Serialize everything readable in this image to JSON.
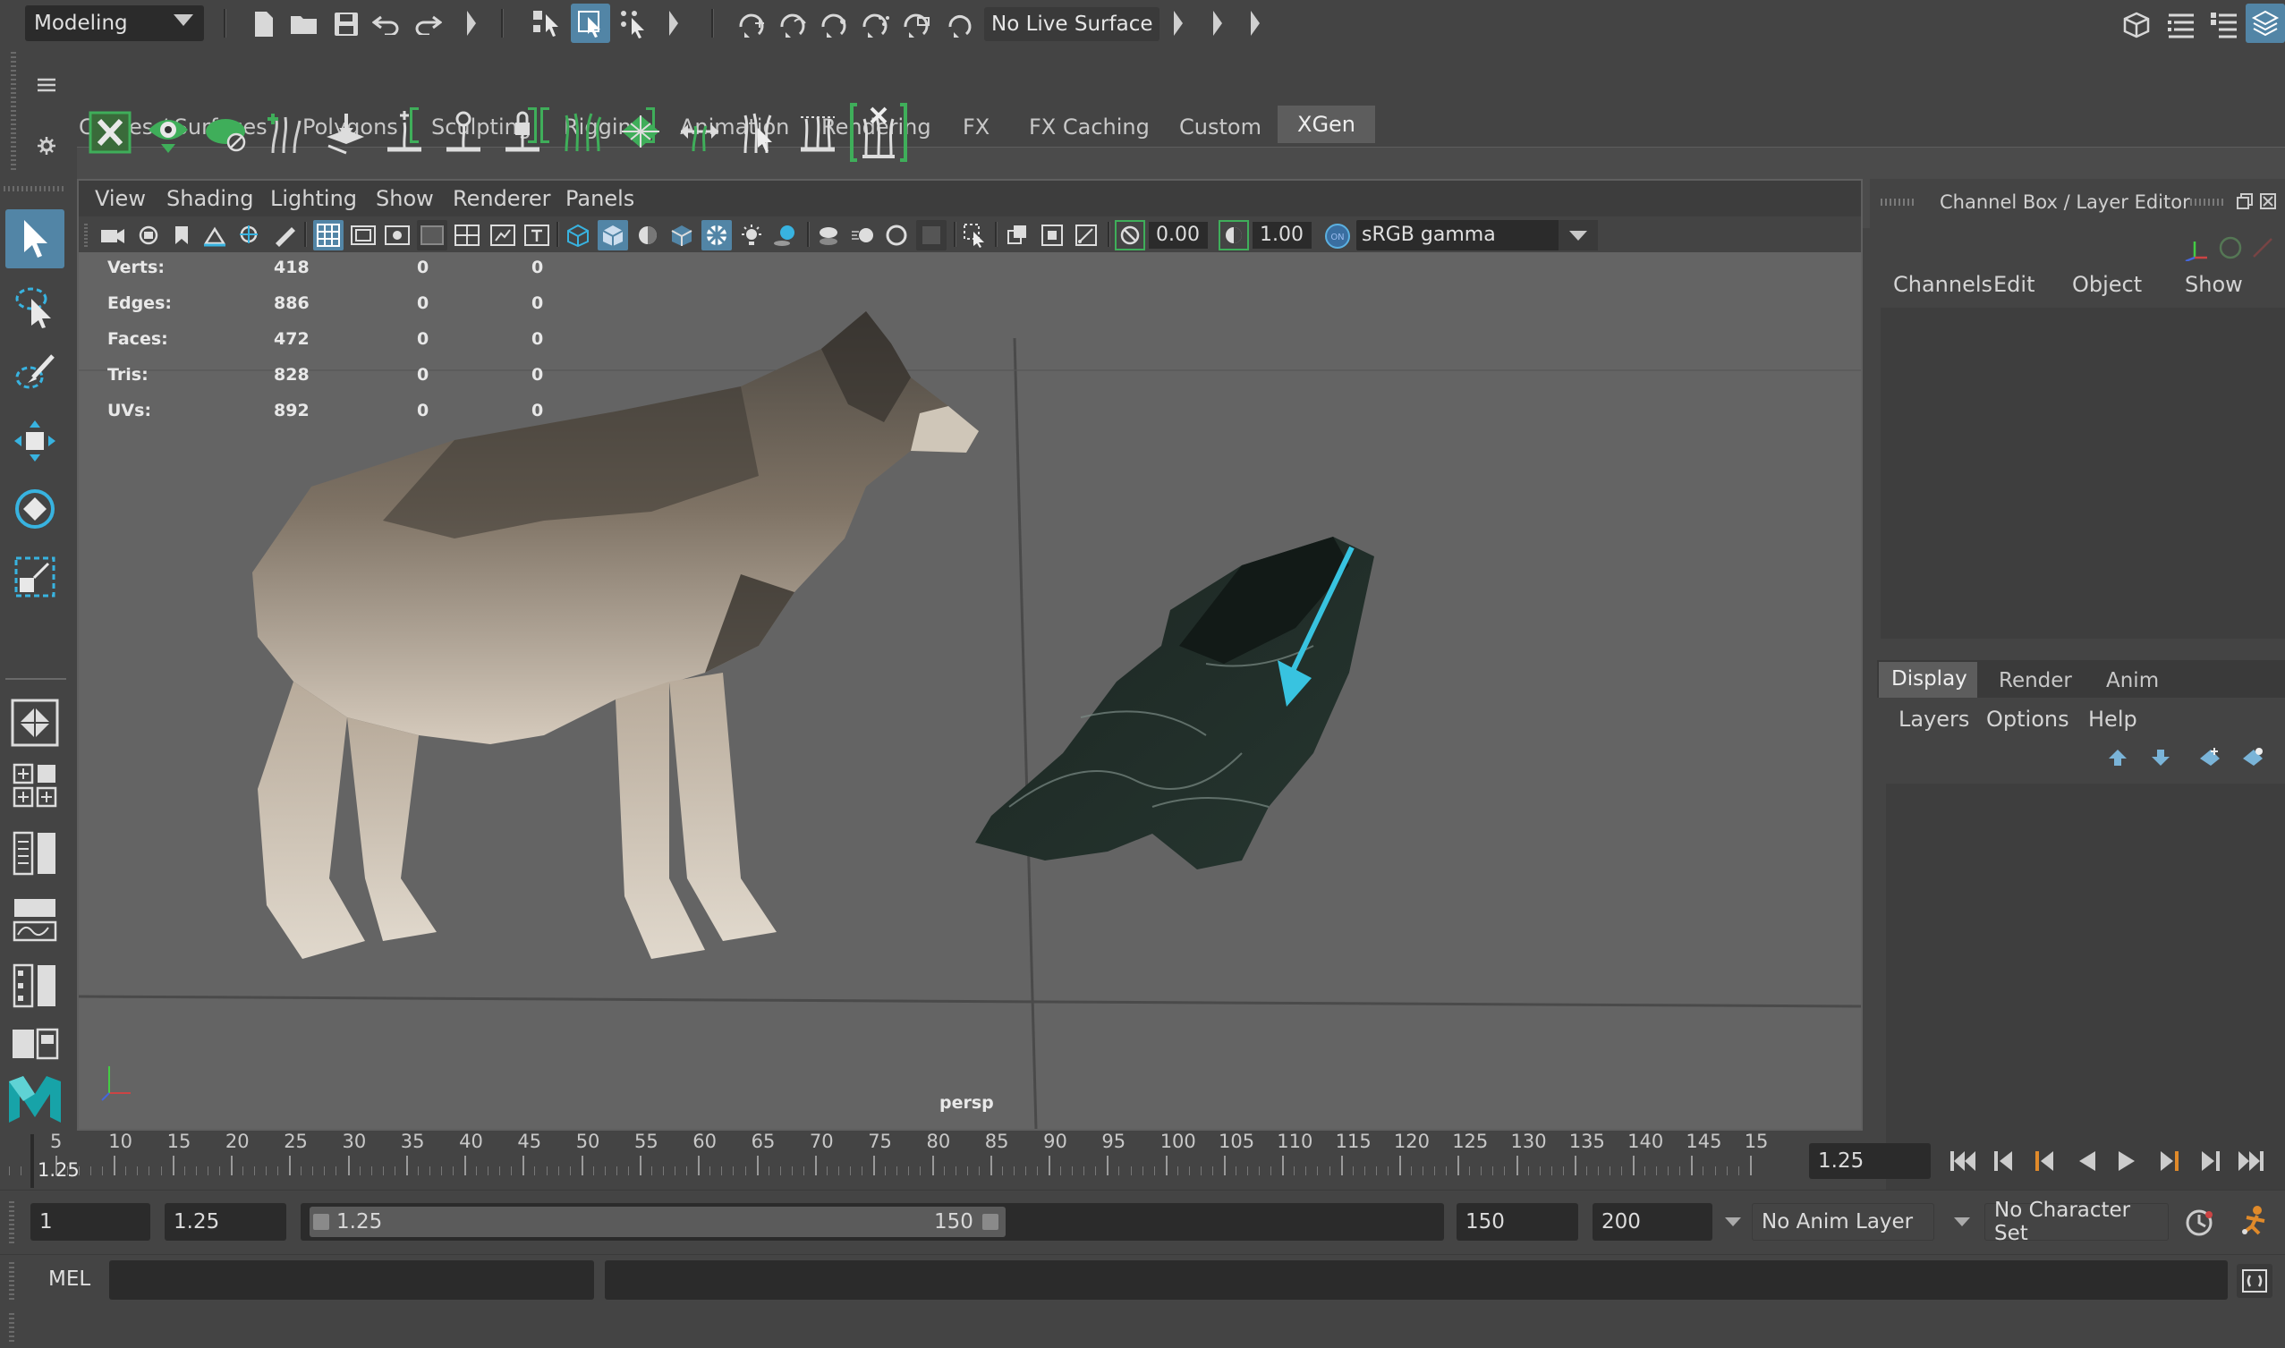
{
  "status_line": {
    "menu_set": "Modeling",
    "live_surface": "No Live Surface"
  },
  "shelf": {
    "tabs": [
      "Curves / Surfaces",
      "Polygons",
      "Sculpting",
      "Rigging",
      "Animation",
      "Rendering",
      "FX",
      "FX Caching",
      "Custom",
      "XGen"
    ],
    "active_tab": "XGen"
  },
  "panel_menu": [
    "View",
    "Shading",
    "Lighting",
    "Show",
    "Renderer",
    "Panels"
  ],
  "panel_toolbar": {
    "exposure": "0.00",
    "gamma": "1.00",
    "color_space": "sRGB gamma"
  },
  "hud": {
    "rows": [
      {
        "label": "Verts:",
        "a": "418",
        "b": "0",
        "c": "0"
      },
      {
        "label": "Edges:",
        "a": "886",
        "b": "0",
        "c": "0"
      },
      {
        "label": "Faces:",
        "a": "472",
        "b": "0",
        "c": "0"
      },
      {
        "label": "Tris:",
        "a": "828",
        "b": "0",
        "c": "0"
      },
      {
        "label": "UVs:",
        "a": "892",
        "b": "0",
        "c": "0"
      }
    ],
    "camera": "persp"
  },
  "channel_box": {
    "title": "Channel Box / Layer Editor",
    "menus": [
      "Channels",
      "Edit",
      "Object",
      "Show"
    ]
  },
  "layer_editor": {
    "tabs": [
      "Display",
      "Render",
      "Anim"
    ],
    "active_tab": "Display",
    "menus": [
      "Layers",
      "Options",
      "Help"
    ]
  },
  "timeline": {
    "ticks": [
      "5",
      "10",
      "15",
      "20",
      "25",
      "30",
      "35",
      "40",
      "45",
      "50",
      "55",
      "60",
      "65",
      "70",
      "75",
      "80",
      "85",
      "90",
      "95",
      "100",
      "105",
      "110",
      "115",
      "120",
      "125",
      "130",
      "135",
      "140",
      "145",
      "15"
    ],
    "current_frame_label": "1.25",
    "current_frame_field": "1.25"
  },
  "range_slider": {
    "start": "1",
    "playback_start": "1.25",
    "slider_start": "1.25",
    "slider_end": "150",
    "playback_end": "150",
    "end": "200",
    "anim_layer": "No Anim Layer",
    "character_set": "No Character Set"
  },
  "command_line": {
    "language": "MEL"
  },
  "colors": {
    "background": "#444444",
    "viewport": "#646464",
    "accent": "#5285a6",
    "shelf_green": "#3fae5a",
    "manipulator": "#38c3e0"
  }
}
